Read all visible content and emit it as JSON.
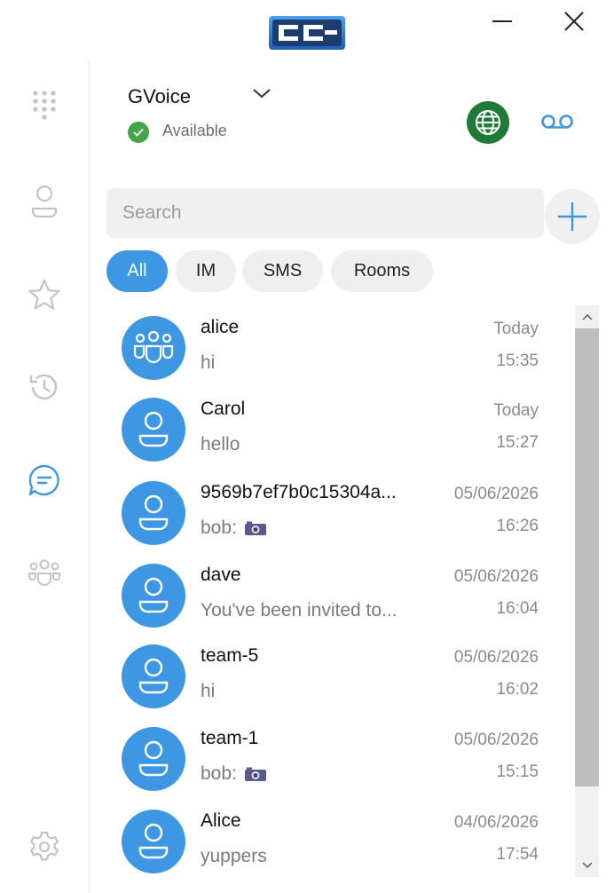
{
  "window": {
    "logo": "cc-logo-icon",
    "minimize": "minimize-icon",
    "close": "close-icon"
  },
  "sidebar": {
    "items": [
      {
        "name": "dialpad",
        "icon": "dialpad-icon",
        "active": false
      },
      {
        "name": "contacts",
        "icon": "person-icon",
        "active": false
      },
      {
        "name": "favorites",
        "icon": "star-icon",
        "active": false
      },
      {
        "name": "history",
        "icon": "history-icon",
        "active": false
      },
      {
        "name": "chats",
        "icon": "chat-icon",
        "active": true
      },
      {
        "name": "groups",
        "icon": "group-icon",
        "active": false
      },
      {
        "name": "settings",
        "icon": "gear-icon",
        "active": false
      }
    ]
  },
  "header": {
    "account_name": "GVoice",
    "status": "Available",
    "status_color": "#45a447",
    "globe_color": "#1e7a34"
  },
  "search": {
    "placeholder": "Search"
  },
  "tabs": [
    {
      "label": "All",
      "active": true
    },
    {
      "label": "IM",
      "active": false
    },
    {
      "label": "SMS",
      "active": false
    },
    {
      "label": "Rooms",
      "active": false
    }
  ],
  "colors": {
    "accent": "#3d97e2"
  },
  "conversations": [
    {
      "name": "alice",
      "message": "hi",
      "date": "Today",
      "time": "15:35",
      "avatar": "group-avatar-icon",
      "attachment": false
    },
    {
      "name": "Carol",
      "message": "hello",
      "date": "Today",
      "time": "15:27",
      "avatar": "person-avatar-icon",
      "attachment": false
    },
    {
      "name": "9569b7ef7b0c15304a...",
      "message": "bob:",
      "date": "05/06/2026",
      "time": "16:26",
      "avatar": "person-avatar-icon",
      "attachment": true
    },
    {
      "name": "dave",
      "message": "You've been invited to...",
      "date": "05/06/2026",
      "time": "16:04",
      "avatar": "person-avatar-icon",
      "attachment": false
    },
    {
      "name": "team-5",
      "message": "hi",
      "date": "05/06/2026",
      "time": "16:02",
      "avatar": "person-avatar-icon",
      "attachment": false
    },
    {
      "name": "team-1",
      "message": "bob:",
      "date": "05/06/2026",
      "time": "15:15",
      "avatar": "person-avatar-icon",
      "attachment": true
    },
    {
      "name": "Alice",
      "message": "yuppers",
      "date": "04/06/2026",
      "time": "17:54",
      "avatar": "person-avatar-icon",
      "attachment": false
    }
  ]
}
